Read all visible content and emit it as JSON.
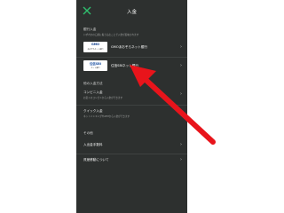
{
  "header": {
    "title": "入金",
    "close_icon": "close-icon"
  },
  "bank_section": {
    "heading": "銀行入金",
    "description": "いずれかの口座に振り込むことで入金が反映されます",
    "banks": [
      {
        "logo_text": "GMO",
        "logo_sub": "あおぞらネット銀行",
        "name": "GMOあおぞらネット銀行"
      },
      {
        "logo_text": "住信SBI",
        "logo_sub": "ネット銀行",
        "name": "住信SBIネット銀行"
      }
    ]
  },
  "other_section": {
    "heading": "他の入金方法",
    "items": [
      {
        "label": "コンビニ入金",
        "sub": "お近くのコンビニから入金ができます"
      },
      {
        "label": "クイック入金",
        "sub": "ネットバンキングやATMから入金ができます"
      }
    ]
  },
  "misc_section": {
    "heading": "その他",
    "items": [
      {
        "label": "入出金手数料"
      },
      {
        "label": "資産移動について"
      }
    ]
  },
  "chevron": "›",
  "colors": {
    "phone_bg": "#2d302f",
    "accent_green": "#2fbf6f",
    "arrow_red": "#e8141b"
  }
}
